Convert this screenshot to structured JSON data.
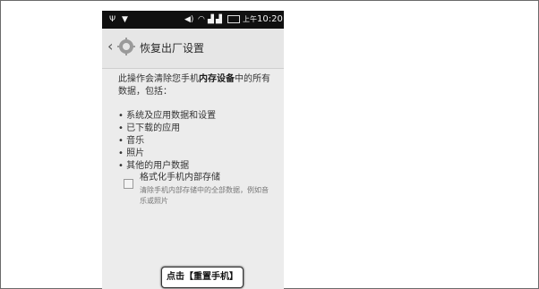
{
  "status_bar": {
    "time_prefix": "上午",
    "time": "10:20"
  },
  "header": {
    "title": "恢复出厂设置",
    "back_icon": "chevron-left-icon",
    "settings_icon": "gear-icon"
  },
  "intro": {
    "part1": "此操作会清除您手机",
    "bold": "内存设备",
    "part2": "中的所有数据，包括："
  },
  "bullets": [
    "• 系统及应用数据和设置",
    "• 已下载的应用",
    "• 音乐",
    "• 照片",
    "• 其他的用户数据"
  ],
  "option": {
    "label": "格式化手机内部存储",
    "description": "清除手机内部存储中的全部数据，例如音乐或照片",
    "checked": false
  },
  "reset_button_label": "点击【重置手机】"
}
